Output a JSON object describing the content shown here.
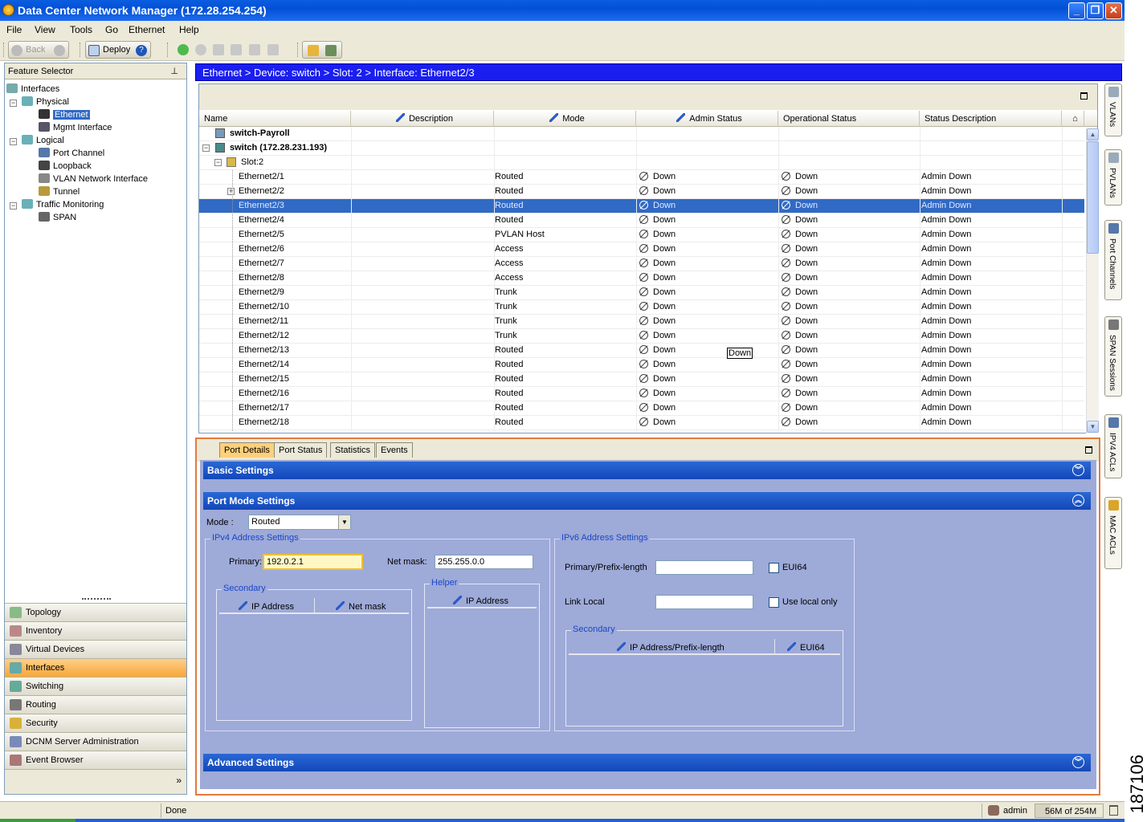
{
  "window": {
    "title": "Data Center Network Manager (172.28.254.254)"
  },
  "menu": [
    "File",
    "View",
    "Tools",
    "Go",
    "Ethernet",
    "Help"
  ],
  "toolbar": {
    "back_label": "Back",
    "deploy_label": "Deploy"
  },
  "feature_selector": {
    "title": "Feature Selector",
    "tree": {
      "interfaces": "Interfaces",
      "physical": "Physical",
      "ethernet": "Ethernet",
      "mgmt": "Mgmt Interface",
      "logical": "Logical",
      "port_channel": "Port Channel",
      "loopback": "Loopback",
      "vlan_if": "VLAN Network Interface",
      "tunnel": "Tunnel",
      "traffic": "Traffic Monitoring",
      "span": "SPAN"
    },
    "nav": [
      "Topology",
      "Inventory",
      "Virtual Devices",
      "Interfaces",
      "Switching",
      "Routing",
      "Security",
      "DCNM Server Administration",
      "Event Browser"
    ],
    "nav_active": "Interfaces"
  },
  "breadcrumb": "Ethernet > Device: switch > Slot: 2 > Interface: Ethernet2/3",
  "table": {
    "columns": [
      "Name",
      "Description",
      "Mode",
      "Admin Status",
      "Operational Status",
      "Status  Description"
    ],
    "group1": "switch-Payroll",
    "group2": "switch (172.28.231.193)",
    "slot": "Slot:2",
    "rows": [
      {
        "name": "Ethernet2/1",
        "mode": "Routed",
        "admin": "Down",
        "oper": "Down",
        "desc": "Admin Down"
      },
      {
        "name": "Ethernet2/2",
        "mode": "Routed",
        "admin": "Down",
        "oper": "Down",
        "desc": "Admin Down"
      },
      {
        "name": "Ethernet2/3",
        "mode": "Routed",
        "admin": "Down",
        "oper": "Down",
        "desc": "Admin Down"
      },
      {
        "name": "Ethernet2/4",
        "mode": "Routed",
        "admin": "Down",
        "oper": "Down",
        "desc": "Admin Down"
      },
      {
        "name": "Ethernet2/5",
        "mode": "PVLAN Host",
        "admin": "Down",
        "oper": "Down",
        "desc": "Admin Down"
      },
      {
        "name": "Ethernet2/6",
        "mode": "Access",
        "admin": "Down",
        "oper": "Down",
        "desc": "Admin Down"
      },
      {
        "name": "Ethernet2/7",
        "mode": "Access",
        "admin": "Down",
        "oper": "Down",
        "desc": "Admin Down"
      },
      {
        "name": "Ethernet2/8",
        "mode": "Access",
        "admin": "Down",
        "oper": "Down",
        "desc": "Admin Down"
      },
      {
        "name": "Ethernet2/9",
        "mode": "Trunk",
        "admin": "Down",
        "oper": "Down",
        "desc": "Admin Down"
      },
      {
        "name": "Ethernet2/10",
        "mode": "Trunk",
        "admin": "Down",
        "oper": "Down",
        "desc": "Admin Down"
      },
      {
        "name": "Ethernet2/11",
        "mode": "Trunk",
        "admin": "Down",
        "oper": "Down",
        "desc": "Admin Down"
      },
      {
        "name": "Ethernet2/12",
        "mode": "Trunk",
        "admin": "Down",
        "oper": "Down",
        "desc": "Admin Down"
      },
      {
        "name": "Ethernet2/13",
        "mode": "Routed",
        "admin": "Down",
        "oper": "Down",
        "desc": "Admin Down"
      },
      {
        "name": "Ethernet2/14",
        "mode": "Routed",
        "admin": "Down",
        "oper": "Down",
        "desc": "Admin Down"
      },
      {
        "name": "Ethernet2/15",
        "mode": "Routed",
        "admin": "Down",
        "oper": "Down",
        "desc": "Admin Down"
      },
      {
        "name": "Ethernet2/16",
        "mode": "Routed",
        "admin": "Down",
        "oper": "Down",
        "desc": "Admin Down"
      },
      {
        "name": "Ethernet2/17",
        "mode": "Routed",
        "admin": "Down",
        "oper": "Down",
        "desc": "Admin Down"
      },
      {
        "name": "Ethernet2/18",
        "mode": "Routed",
        "admin": "Down",
        "oper": "Down",
        "desc": "Admin Down"
      }
    ],
    "selected_row": "Ethernet2/3",
    "tooltip": "Down"
  },
  "details": {
    "tabs": [
      "Port Details",
      "Port Status",
      "Statistics",
      "Events"
    ],
    "active_tab": "Port Details",
    "basic": "Basic Settings",
    "port_mode": "Port Mode Settings",
    "mode_label": "Mode :",
    "mode_value": "Routed",
    "ipv4": {
      "legend": "IPv4 Address Settings",
      "primary_label": "Primary:",
      "primary_value": "192.0.2.1",
      "netmask_label": "Net mask:",
      "netmask_value": "255.255.0.0",
      "secondary_legend": "Secondary",
      "sec_col1": "IP Address",
      "sec_col2": "Net mask",
      "helper_legend": "Helper",
      "helper_col": "IP Address"
    },
    "ipv6": {
      "legend": "IPv6 Address Settings",
      "primary_label": "Primary/Prefix-length",
      "eui64_label": "EUI64",
      "link_local_label": "Link Local",
      "use_local_label": "Use local only",
      "secondary_legend": "Secondary",
      "sec_col1": "IP Address/Prefix-length",
      "sec_col2": "EUI64"
    },
    "advanced": "Advanced Settings"
  },
  "right_tabs": [
    "VLANs",
    "PVLANs",
    "Port Channels",
    "SPAN Sessions",
    "IPV4 ACLs",
    "MAC ACLs"
  ],
  "status": {
    "text": "Done",
    "user": "admin",
    "memory": "56M of 254M"
  },
  "figure_number": "187106",
  "colors": {
    "title_blue": "#0a5ee0",
    "selection": "#316ac5",
    "panel": "#9eaad8",
    "accent_orange": "#f7a738"
  }
}
